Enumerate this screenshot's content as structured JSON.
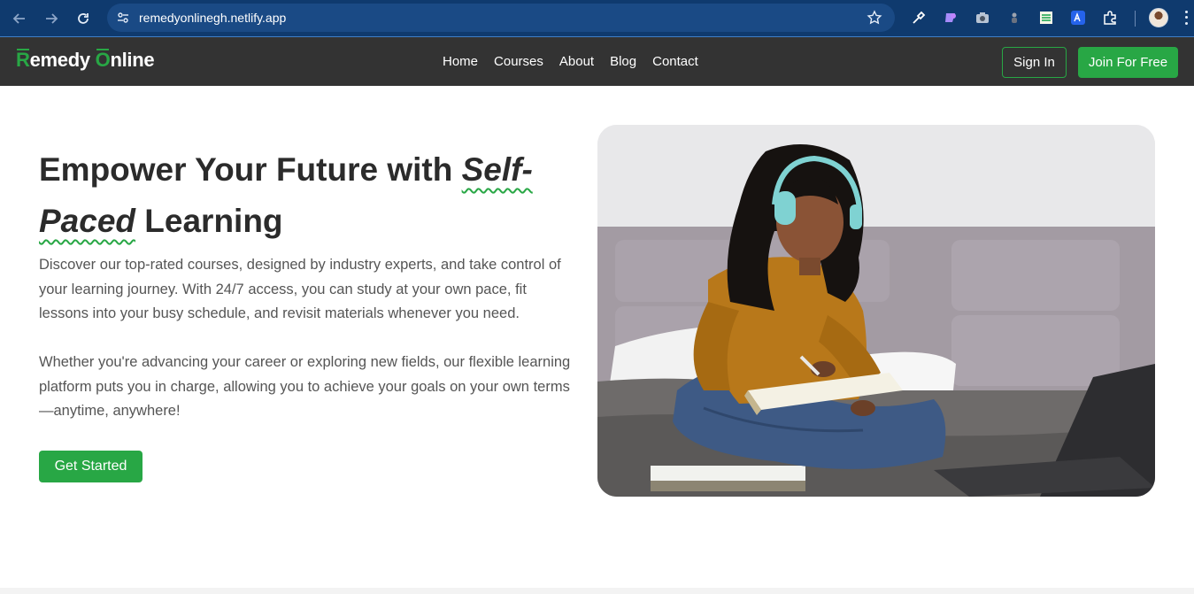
{
  "browser": {
    "url": "remedyonlinegh.netlify.app",
    "icons": [
      "back-icon",
      "forward-icon",
      "reload-icon",
      "site-info-icon",
      "bookmark-star-icon",
      "eyedropper-extension-icon",
      "color-extension-icon",
      "camera-extension-icon",
      "extension-icon",
      "sheet-extension-icon",
      "translate-extension-icon",
      "extensions-puzzle-icon",
      "profile-avatar",
      "menu-dots-icon"
    ]
  },
  "site": {
    "logo_first_letter": "R",
    "logo_rest_first": "emedy ",
    "logo_second_letter": "O",
    "logo_rest_second": "nline",
    "nav": [
      "Home",
      "Courses",
      "About",
      "Blog",
      "Contact"
    ],
    "sign_in": "Sign In",
    "join": "Join For Free"
  },
  "hero": {
    "title_part1": "Empower Your Future with ",
    "title_emphasis1": "Self-",
    "title_emphasis2": "Paced",
    "title_part2": " Learning",
    "paragraph1": "Discover our top-rated courses, designed by industry experts, and take control of your learning journey. With 24/7 access, you can study at your own pace, fit lessons into your busy schedule, and revisit materials whenever you need.",
    "paragraph2": "Whether you're advancing your career or exploring new fields, our flexible learning platform puts you in charge, allowing you to achieve your goals on your own terms—anytime, anywhere!",
    "cta": "Get Started"
  },
  "colors": {
    "accent": "#28a745",
    "navbar": "#333333",
    "browser_bar": "#0f3a6e",
    "heading": "#2b2b2b",
    "body_text": "#555555"
  }
}
